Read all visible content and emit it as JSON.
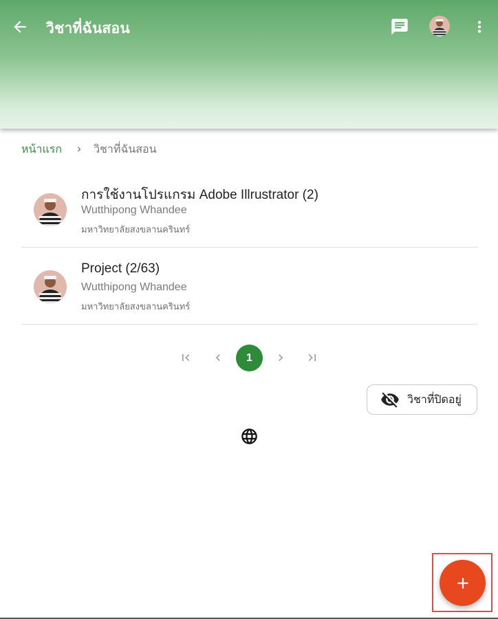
{
  "appbar": {
    "title": "วิชาที่ฉันสอน",
    "icons": {
      "back": "arrow-back-icon",
      "chat": "chat-icon",
      "more": "more-vert-icon"
    },
    "gradient": [
      "#5fa96a",
      "#e6f3e7"
    ]
  },
  "breadcrumb": {
    "home": "หน้าแรก",
    "current": "วิชาที่ฉันสอน"
  },
  "courses": [
    {
      "name": "การใช้งานโปรแกรม Adobe Illrustrator (2)",
      "teacher": "Wutthipong Whandee",
      "school": "มหาวิทยาลัยสงขลานครินทร์"
    },
    {
      "name": "Project (2/63)",
      "teacher": "Wutthipong Whandee",
      "school": "มหาวิทยาลัยสงขลานครินทร์"
    }
  ],
  "pagination": {
    "current_page": "1",
    "accent": "#2e8b3a"
  },
  "closed_courses": {
    "label": "วิชาที่ปิดอยู่",
    "icon": "visibility-off-icon"
  },
  "language": {
    "icon": "globe-icon"
  },
  "fab": {
    "icon": "add-icon",
    "color": "#e8481e"
  }
}
